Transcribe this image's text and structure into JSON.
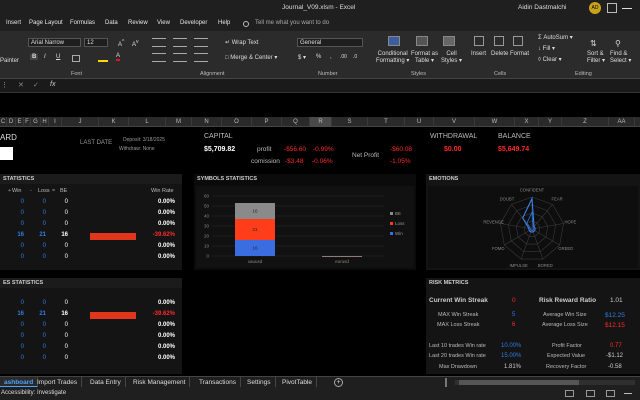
{
  "title": {
    "filename": "Journal_V09.xlsm",
    "app": "Excel",
    "user": "Aidin Dastmalchi",
    "initials": "AD"
  },
  "menu": [
    "Insert",
    "Page Layout",
    "Formulas",
    "Data",
    "Review",
    "View",
    "Developer",
    "Help"
  ],
  "tell_me": "Tell me what you want to do",
  "ribbon": {
    "painter": "Painter",
    "font_name": "Arial Narrow",
    "font_size": "12",
    "font_label": "Font",
    "wrap_text": "Wrap Text",
    "merge_center": "Merge & Center",
    "alignment_label": "Alignment",
    "number_format": "General",
    "number_label": "Number",
    "cond_format": "Conditional",
    "cond_format2": "Formatting",
    "format_as": "Format as",
    "format_as2": "Table",
    "cell": "Cell",
    "cell2": "Styles",
    "styles_label": "Styles",
    "insert": "Insert",
    "delete": "Delete",
    "format": "Format",
    "cells_label": "Cells",
    "autosum": "AutoSum",
    "fill": "Fill",
    "clear": "Clear",
    "sort": "Sort &",
    "sort2": "Filter",
    "find": "Find &",
    "find2": "Select",
    "editing_label": "Editing"
  },
  "columns": [
    "C",
    "D",
    "E",
    "F",
    "G",
    "H",
    "I",
    "J",
    "K",
    "L",
    "M",
    "N",
    "O",
    "P",
    "Q",
    "R",
    "S",
    "T",
    "U",
    "V",
    "W",
    "X",
    "Y",
    "Z",
    "AA",
    "AB"
  ],
  "header": {
    "board": "ARD",
    "last_date": "LAST DATE",
    "deposit": "Deposit: 3/18/2025",
    "withdraw": "Withdraw: None",
    "capital_label": "CAPITAL",
    "capital_value": "$5,709.82",
    "profit_label": "profit",
    "profit_value": "-$56.60",
    "profit_pct": "-0.99%",
    "commission_label": "comission",
    "commission_value": "-$3.48",
    "commission_pct": "-0.06%",
    "net_profit_label": "Net Profit",
    "net_profit_value": "-$60.08",
    "net_profit_pct": "-1.05%",
    "withdrawal_label": "WITHDRAWAL",
    "withdrawal_value": "$0.00",
    "balance_label": "BALANCE",
    "balance_value": "$5,649.74"
  },
  "stats1": {
    "title": "STATISTICS",
    "cols": [
      "Win",
      "Loss",
      "BE",
      "Win Rate"
    ],
    "rows": [
      [
        "0",
        "0",
        "0",
        "0.00%"
      ],
      [
        "0",
        "0",
        "0",
        "0.00%"
      ],
      [
        "0",
        "0",
        "0",
        "0.00%"
      ],
      [
        "16",
        "21",
        "16",
        "-39.62%"
      ],
      [
        "0",
        "0",
        "0",
        "0.00%"
      ],
      [
        "0",
        "0",
        "0",
        "0.00%"
      ]
    ]
  },
  "stats2": {
    "title": "ES STATISTICS",
    "rows": [
      [
        "0",
        "0",
        "0",
        "0.00%"
      ],
      [
        "16",
        "21",
        "16",
        "-39.62%"
      ],
      [
        "0",
        "0",
        "0",
        "0.00%"
      ],
      [
        "0",
        "0",
        "0",
        "0.00%"
      ],
      [
        "0",
        "0",
        "0",
        "0.00%"
      ],
      [
        "0",
        "0",
        "0",
        "0.00%"
      ]
    ]
  },
  "symbols": {
    "title": "SYMBOLS STATISTICS"
  },
  "chart_data": {
    "type": "bar",
    "title": "",
    "categories": [
      "xauusd",
      "eurusd"
    ],
    "stacked": true,
    "series": [
      {
        "name": "Win",
        "values": [
          16,
          0
        ],
        "color": "#3a6ee0"
      },
      {
        "name": "Loss",
        "values": [
          21,
          0
        ],
        "color": "#ff3d1a"
      },
      {
        "name": "BE",
        "values": [
          16,
          0
        ],
        "color": "#8a8a8a"
      }
    ],
    "ylim": [
      0,
      60
    ],
    "yticks": [
      "0",
      "10",
      "20",
      "30",
      "40",
      "50",
      "60"
    ],
    "data_labels": [
      "16",
      "21",
      "16"
    ],
    "legend": "right"
  },
  "emotions": {
    "title": "EMOTIONS",
    "axes": [
      "CONFIDENT",
      "FEAR",
      "HOPE",
      "GREED",
      "BORED",
      "IMPULSE",
      "FOMO",
      "REVENGE",
      "DOUBT"
    ]
  },
  "risk": {
    "title": "RISK METRICS",
    "current_streak_label": "Current Win Streak",
    "current_streak": "0",
    "rr_label": "Risk Reward Ratio",
    "rr": "1.01",
    "max_win_label": "MAX Win Streak",
    "max_win": "5",
    "avg_win_label": "Average Win Size",
    "avg_win": "$12.25",
    "max_loss_label": "MAX Loss Streak",
    "max_loss": "6",
    "avg_loss_label": "Average Loss Size",
    "avg_loss": "$12.15",
    "last10_label": "Last 10 trades Win rate",
    "last10": "10.00%",
    "pf_label": "Profit Factor",
    "pf": "0.77",
    "last20_label": "Last 20 trades Win rate",
    "last20": "15.00%",
    "ev_label": "Expected Value",
    "ev": "-$1.12",
    "dd_label": "Max Drawdown",
    "dd": "1.81%",
    "rf_label": "Recovery Factor",
    "rf": "-0.58"
  },
  "tabs": [
    "ashboard",
    "Import Trades",
    "Data Entry",
    "Risk Management",
    "Transactions",
    "Settings",
    "PivotTable"
  ],
  "status": {
    "accessibility": "Accessibility: Investigate"
  }
}
